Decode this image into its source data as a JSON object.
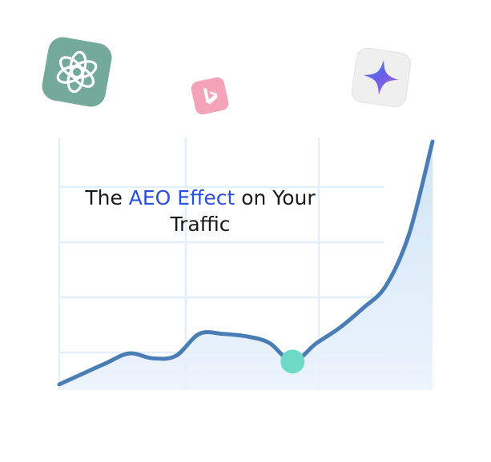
{
  "chart_data": {
    "type": "area",
    "title_parts": [
      {
        "text": "The ",
        "accent": false
      },
      {
        "text": "AEO Effect",
        "accent": true
      },
      {
        "text": " on Your",
        "accent": false
      }
    ],
    "title_line2": "Traffic",
    "x": [
      0,
      1,
      2,
      3,
      4,
      5,
      6,
      7,
      8,
      9,
      10,
      11,
      12,
      13,
      14,
      15,
      16
    ],
    "values": [
      0.07,
      0.2,
      0.33,
      0.45,
      0.39,
      0.42,
      0.69,
      0.69,
      0.66,
      0.58,
      0.35,
      0.57,
      0.76,
      1.0,
      1.28,
      1.92,
      3.05
    ],
    "highlight_index": 10,
    "xlim": [
      0,
      16
    ],
    "ylim": [
      0,
      3.1
    ],
    "grid": true,
    "legend": "none",
    "colors": {
      "line": "#4a7db5",
      "fill": "#d9e9f8",
      "grid": "#e3f0fb",
      "highlight": "#6fd9c8",
      "title": "#1a1a1a",
      "accent": "#2a4fe0"
    }
  },
  "icons": [
    {
      "name": "chatgpt-icon",
      "color": "#74aa9c"
    },
    {
      "name": "bing-icon",
      "color": "#f5a3b8"
    },
    {
      "name": "gemini-icon",
      "color": "#efefef"
    }
  ]
}
